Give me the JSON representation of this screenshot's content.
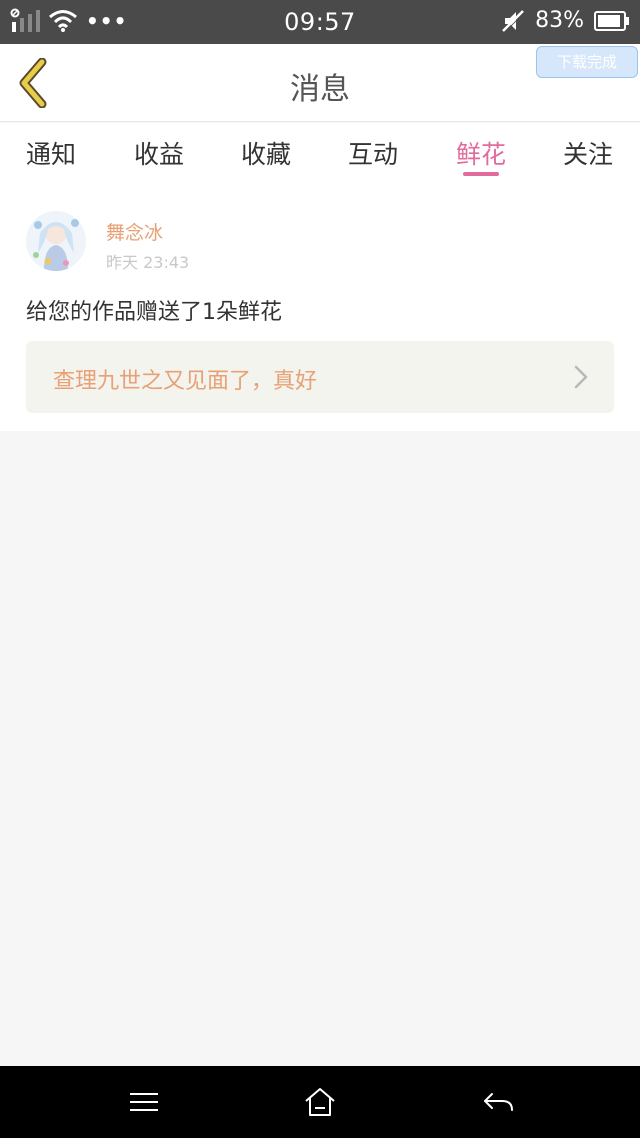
{
  "status_bar": {
    "time": "09:57",
    "battery": "83%",
    "icons": [
      "signal-icon",
      "wifi-icon",
      "more-dots-icon",
      "mute-icon",
      "battery-icon"
    ]
  },
  "header": {
    "title": "消息",
    "back_icon": "back-chevron-icon",
    "toast": "下载完成"
  },
  "tabs": [
    {
      "label": "通知",
      "active": false
    },
    {
      "label": "收益",
      "active": false
    },
    {
      "label": "收藏",
      "active": false
    },
    {
      "label": "互动",
      "active": false
    },
    {
      "label": "鲜花",
      "active": true
    },
    {
      "label": "关注",
      "active": false
    }
  ],
  "notification": {
    "username": "舞念冰",
    "timestamp": "昨天 23:43",
    "message": "给您的作品赠送了1朵鲜花",
    "work_title": "查理九世之又见面了，真好"
  },
  "nav_bar": {
    "icons": [
      "menu-icon",
      "home-icon",
      "back-arrow-icon"
    ]
  },
  "colors": {
    "accent": "#e26b9d",
    "username": "#e8a074",
    "back_icon": "#e8cc4c",
    "status_bar_bg": "#4a4a4a",
    "page_bg": "#f6f6f6"
  }
}
